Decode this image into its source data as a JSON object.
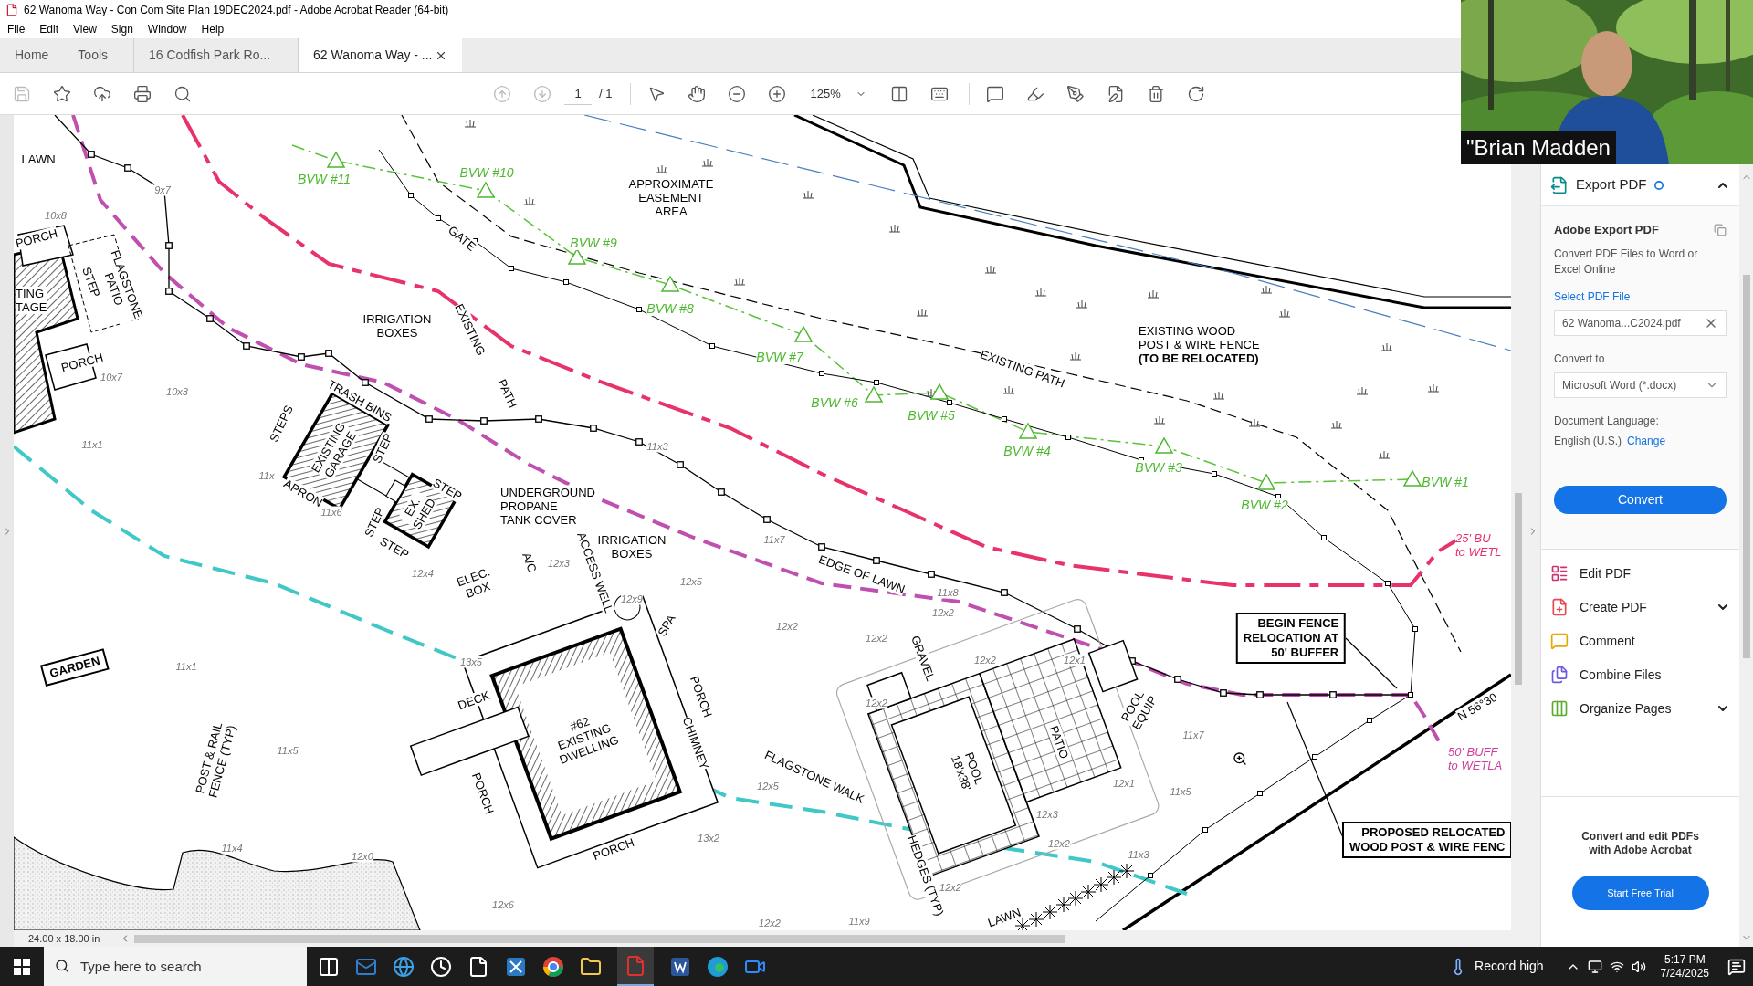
{
  "window": {
    "title": "62 Wanoma Way - Con Com Site Plan 19DEC2024.pdf - Adobe Acrobat Reader (64-bit)"
  },
  "menu": [
    "File",
    "Edit",
    "View",
    "Sign",
    "Window",
    "Help"
  ],
  "tabs": [
    {
      "label": "Home",
      "kind": "nav",
      "selected": false
    },
    {
      "label": "Tools",
      "kind": "nav",
      "selected": false
    },
    {
      "label": "16 Codfish Park Ro...",
      "kind": "doc",
      "selected": false
    },
    {
      "label": "62 Wanoma Way - ...",
      "kind": "doc",
      "selected": true
    }
  ],
  "toolbar": {
    "page": "1",
    "page_total": "/ 1",
    "zoom": "125%"
  },
  "video": {
    "name": "\"Brian Madden"
  },
  "plan": {
    "labels": [
      {
        "kind": "note",
        "lines": [
          "LAWN"
        ]
      },
      {
        "kind": "note",
        "lines": [
          "APPROXIMATE",
          "EASEMENT",
          "AREA"
        ]
      },
      {
        "kind": "flag",
        "lines": [
          "BVW #11"
        ]
      },
      {
        "kind": "flag",
        "lines": [
          "BVW #10"
        ]
      },
      {
        "kind": "flag",
        "lines": [
          "BVW #9"
        ]
      },
      {
        "kind": "flag",
        "lines": [
          "BVW #8"
        ]
      },
      {
        "kind": "flag",
        "lines": [
          "BVW #7"
        ]
      },
      {
        "kind": "flag",
        "lines": [
          "BVW #6"
        ]
      },
      {
        "kind": "flag",
        "lines": [
          "BVW #5"
        ]
      },
      {
        "kind": "flag",
        "lines": [
          "BVW #4"
        ]
      },
      {
        "kind": "flag",
        "lines": [
          "BVW #3"
        ]
      },
      {
        "kind": "flag",
        "lines": [
          "BVW #2"
        ]
      },
      {
        "kind": "flag",
        "lines": [
          "BVW #1"
        ]
      },
      {
        "kind": "note",
        "lines": [
          "PORCH"
        ]
      },
      {
        "kind": "note",
        "lines": [
          "TING",
          "TAGE"
        ]
      },
      {
        "kind": "note",
        "lines": [
          "STEP"
        ]
      },
      {
        "kind": "note",
        "lines": [
          "FLAGSTONE",
          "PATIO"
        ]
      },
      {
        "kind": "note",
        "lines": [
          "PORCH"
        ]
      },
      {
        "kind": "dim",
        "lines": [
          "10x8"
        ]
      },
      {
        "kind": "dim",
        "lines": [
          "9x7"
        ]
      },
      {
        "kind": "dim",
        "lines": [
          "10x7"
        ]
      },
      {
        "kind": "dim",
        "lines": [
          "10x3"
        ]
      },
      {
        "kind": "dim",
        "lines": [
          "11x1"
        ]
      },
      {
        "kind": "note",
        "lines": [
          "IRRIGATION",
          "BOXES"
        ]
      },
      {
        "kind": "note",
        "lines": [
          "GATE"
        ]
      },
      {
        "kind": "note",
        "lines": [
          "EXISTING"
        ]
      },
      {
        "kind": "note",
        "lines": [
          "PATH"
        ]
      },
      {
        "kind": "note",
        "lines": [
          "TRASH BINS"
        ]
      },
      {
        "kind": "note",
        "lines": [
          "STEPS"
        ]
      },
      {
        "kind": "note",
        "lines": [
          "EXISTING",
          "GARAGE"
        ]
      },
      {
        "kind": "note",
        "lines": [
          "STEP"
        ]
      },
      {
        "kind": "dim",
        "lines": [
          "11x"
        ]
      },
      {
        "kind": "note",
        "lines": [
          "APRON"
        ]
      },
      {
        "kind": "dim",
        "lines": [
          "11x6"
        ]
      },
      {
        "kind": "note",
        "lines": [
          "EX.",
          "SHED"
        ]
      },
      {
        "kind": "note",
        "lines": [
          "STEP"
        ]
      },
      {
        "kind": "note",
        "lines": [
          "STEP"
        ]
      },
      {
        "kind": "note",
        "lines": [
          "STEP"
        ]
      },
      {
        "kind": "note",
        "lines": [
          "UNDERGROUND",
          "PROPANE",
          "TANK COVER"
        ]
      },
      {
        "kind": "dim",
        "lines": [
          "11x3"
        ]
      },
      {
        "kind": "note",
        "lines": [
          "IRRIGATION",
          "BOXES"
        ]
      },
      {
        "kind": "dim",
        "lines": [
          "11x7"
        ]
      },
      {
        "kind": "note",
        "lines": [
          "EXISTING PATH"
        ]
      },
      {
        "kind": "note",
        "lines": [
          "EXISTING WOOD",
          "POST & WIRE FENCE",
          "**(TO BE RELOCATED)**"
        ]
      },
      {
        "kind": "buffer",
        "color": "#e8336a",
        "lines": [
          "25' BU",
          "to WETL"
        ]
      },
      {
        "kind": "dim",
        "lines": [
          "12x4"
        ]
      },
      {
        "kind": "note",
        "lines": [
          "ELEC.",
          "BOX"
        ]
      },
      {
        "kind": "note",
        "lines": [
          "A/C"
        ]
      },
      {
        "kind": "note",
        "lines": [
          "ACCESS WELL"
        ]
      },
      {
        "kind": "dim",
        "lines": [
          "12x3"
        ]
      },
      {
        "kind": "dim",
        "lines": [
          "12x9"
        ]
      },
      {
        "kind": "dim",
        "lines": [
          "12x5"
        ]
      },
      {
        "kind": "note",
        "lines": [
          "SPA"
        ]
      },
      {
        "kind": "note",
        "lines": [
          "PORCH"
        ]
      },
      {
        "kind": "note",
        "lines": [
          "CHIMNEY"
        ]
      },
      {
        "kind": "dim",
        "lines": [
          "13x5"
        ]
      },
      {
        "kind": "note",
        "lines": [
          "DECK"
        ]
      },
      {
        "kind": "note",
        "lines": [
          "#62",
          "EXISTING",
          "DWELLING"
        ]
      },
      {
        "kind": "boxed",
        "lines": [
          "GARDEN"
        ]
      },
      {
        "kind": "dim",
        "lines": [
          "11x1"
        ]
      },
      {
        "kind": "note",
        "lines": [
          "POST & RAIL",
          "FENCE (TYP)"
        ]
      },
      {
        "kind": "dim",
        "lines": [
          "11x5"
        ]
      },
      {
        "kind": "note",
        "lines": [
          "PORCH"
        ]
      },
      {
        "kind": "note",
        "lines": [
          "PORCH"
        ]
      },
      {
        "kind": "dim",
        "lines": [
          "13x2"
        ]
      },
      {
        "kind": "dim",
        "lines": [
          "11x4"
        ]
      },
      {
        "kind": "dim",
        "lines": [
          "12x0"
        ]
      },
      {
        "kind": "dim",
        "lines": [
          "12x6"
        ]
      },
      {
        "kind": "note",
        "lines": [
          "EDGE OF LAWN"
        ]
      },
      {
        "kind": "dim",
        "lines": [
          "11x8"
        ]
      },
      {
        "kind": "dim",
        "lines": [
          "12x2"
        ]
      },
      {
        "kind": "dim",
        "lines": [
          "12x2"
        ]
      },
      {
        "kind": "dim",
        "lines": [
          "12x2"
        ]
      },
      {
        "kind": "note",
        "lines": [
          "GRAVEL"
        ]
      },
      {
        "kind": "dim",
        "lines": [
          "12x2"
        ]
      },
      {
        "kind": "dim",
        "lines": [
          "12x1"
        ]
      },
      {
        "kind": "dim",
        "lines": [
          "12x2"
        ]
      },
      {
        "kind": "note",
        "lines": [
          "POOL",
          "18'x38'"
        ]
      },
      {
        "kind": "note",
        "lines": [
          "PATIO"
        ]
      },
      {
        "kind": "note",
        "lines": [
          "POOL",
          "EQUIP"
        ]
      },
      {
        "kind": "dim",
        "lines": [
          "11x7"
        ]
      },
      {
        "kind": "dim",
        "lines": [
          "12x1"
        ]
      },
      {
        "kind": "dim",
        "lines": [
          "11x5"
        ]
      },
      {
        "kind": "dim",
        "lines": [
          "12x3"
        ]
      },
      {
        "kind": "dim",
        "lines": [
          "12x2"
        ]
      },
      {
        "kind": "dim",
        "lines": [
          "11x3"
        ]
      },
      {
        "kind": "dim",
        "lines": [
          "12x2"
        ]
      },
      {
        "kind": "note",
        "lines": [
          "HEDGES (TYP)"
        ]
      },
      {
        "kind": "note",
        "lines": [
          "FLAGSTONE WALK"
        ]
      },
      {
        "kind": "dim",
        "lines": [
          "12x5"
        ]
      },
      {
        "kind": "note",
        "lines": [
          "LAWN"
        ]
      },
      {
        "kind": "dim",
        "lines": [
          "11x9"
        ]
      },
      {
        "kind": "dim",
        "lines": [
          "12x2"
        ]
      },
      {
        "kind": "boxed",
        "lines": [
          "BEGIN FENCE",
          "RELOCATION AT",
          "50' BUFFER"
        ]
      },
      {
        "kind": "note",
        "lines": [
          "N 56°30"
        ]
      },
      {
        "kind": "buffer",
        "color": "#d0409a",
        "lines": [
          "50' BUFF",
          "to WETLA"
        ]
      },
      {
        "kind": "boxed",
        "lines": [
          "PROPOSED RELOCATED",
          "WOOD POST & WIRE FENC"
        ]
      }
    ]
  },
  "status": {
    "page_size": "24.00 x 18.00 in"
  },
  "panel": {
    "header": "Export PDF",
    "title": "Adobe Export PDF",
    "description": "Convert PDF Files to Word or Excel Online",
    "select_label": "Select PDF File",
    "file": "62 Wanoma...C2024.pdf",
    "convert_to_label": "Convert to",
    "format": "Microsoft Word (*.docx)",
    "language_label": "Document Language:",
    "language": "English (U.S.)",
    "change": "Change",
    "convert_button": "Convert",
    "tools": [
      {
        "label": "Edit PDF",
        "kind": "edit",
        "expandable": false
      },
      {
        "label": "Create PDF",
        "kind": "create",
        "expandable": true
      },
      {
        "label": "Comment",
        "kind": "comment",
        "expandable": false
      },
      {
        "label": "Combine Files",
        "kind": "combine",
        "expandable": false
      },
      {
        "label": "Organize Pages",
        "kind": "organize",
        "expandable": true
      }
    ],
    "promo": "Convert and edit PDFs with Adobe Acrobat",
    "trial_button": "Start Free Trial"
  },
  "taskbar": {
    "search_placeholder": "Type here to search",
    "weather": "Record high",
    "time": "5:17 PM",
    "date": "7/24/2025"
  }
}
